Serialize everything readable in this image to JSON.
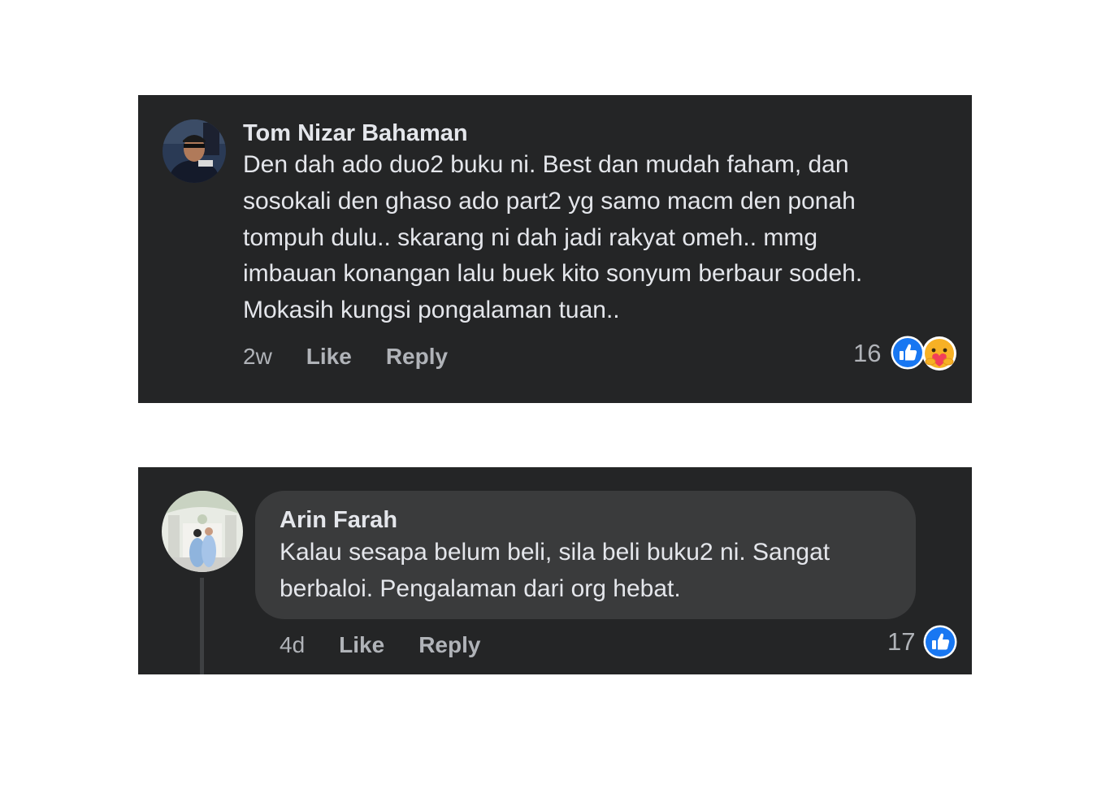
{
  "comments": [
    {
      "author": "Tom Nizar Bahaman",
      "lines": [
        "Den dah ado duo2 buku ni. Best dan mudah faham, dan",
        "sosokali den ghaso ado part2 yg samo macm den ponah",
        "tompuh dulu.. skarang ni dah jadi rakyat omeh.. mmg",
        "imbauan konangan lalu buek kito sonyum berbaur sodeh.",
        "Mokasih kungsi pongalaman tuan.."
      ],
      "time": "2w",
      "like_label": "Like",
      "reply_label": "Reply",
      "reaction_count": "16",
      "reactions": [
        "like-icon",
        "care-icon"
      ]
    },
    {
      "author": "Arin Farah",
      "lines": [
        "Kalau sesapa belum beli, sila beli buku2 ni. Sangat",
        "berbaloi. Pengalaman dari org hebat."
      ],
      "time": "4d",
      "like_label": "Like",
      "reply_label": "Reply",
      "reaction_count": "17",
      "reactions": [
        "like-icon"
      ]
    }
  ],
  "colors": {
    "panel_background": "#242526",
    "bubble_background": "#3a3b3c",
    "primary_text": "#e4e6eb",
    "secondary_text": "#b0b3b8",
    "like_blue": "#1877f2",
    "care_yellow": "#f7b125"
  }
}
